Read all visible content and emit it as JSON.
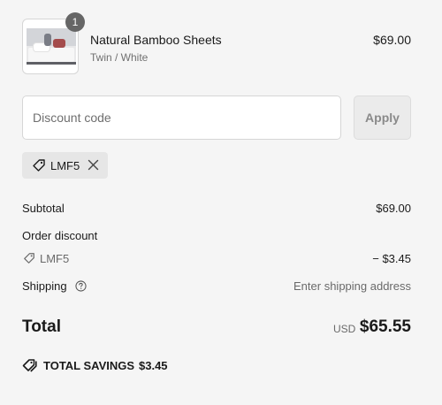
{
  "line_item": {
    "quantity": "1",
    "name": "Natural Bamboo Sheets",
    "variant": "Twin / White",
    "price": "$69.00"
  },
  "discount": {
    "placeholder": "Discount code",
    "apply_label": "Apply",
    "applied_code": "LMF5"
  },
  "summary": {
    "subtotal_label": "Subtotal",
    "subtotal_value": "$69.00",
    "order_discount_label": "Order discount",
    "discount_code": "LMF5",
    "discount_value": "− $3.45",
    "shipping_label": "Shipping",
    "shipping_value": "Enter shipping address",
    "total_label": "Total",
    "currency": "USD",
    "total_value": "$65.55",
    "savings_label": "TOTAL SAVINGS",
    "savings_value": "$3.45"
  },
  "icons": {
    "tag": "tag-icon",
    "close": "close-icon",
    "help": "help-icon",
    "savings": "savings-tag-icon"
  },
  "colors": {
    "background": "#f5f5f5",
    "badge": "#666666",
    "chip": "#e6e6e6",
    "apply_button": "#ebebeb"
  }
}
